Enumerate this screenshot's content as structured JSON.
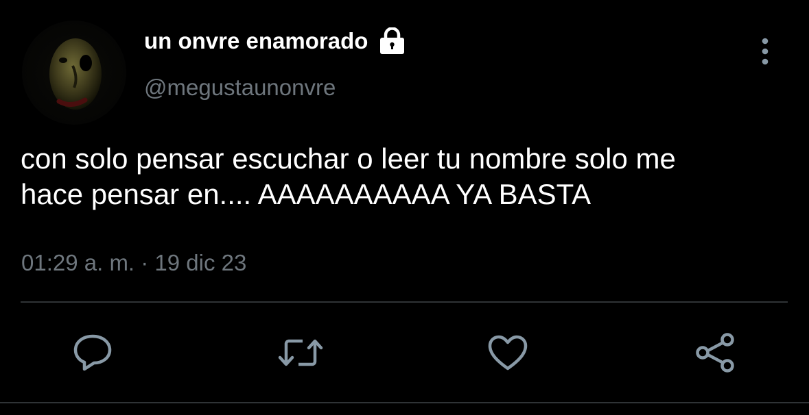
{
  "tweet": {
    "display_name": "un onvre enamorado",
    "handle": "@megustaunonvre",
    "text": "con solo pensar escuchar o leer tu nombre solo me\nhace pensar en.... AAAAAAAAAA YA BASTA",
    "timestamp": "01:29 a. m. · 19 dic 23",
    "protected": true
  },
  "icons": {
    "avatar": "avatar-image",
    "lock": "lock-icon",
    "more": "more-vertical-icon",
    "reply": "reply-icon",
    "retweet": "retweet-icon",
    "like": "heart-icon",
    "share": "share-icon"
  },
  "colors": {
    "background": "#000000",
    "text": "#ffffff",
    "secondary_text": "#6e767d",
    "icon": "#8899a6",
    "divider": "#2f3336"
  }
}
